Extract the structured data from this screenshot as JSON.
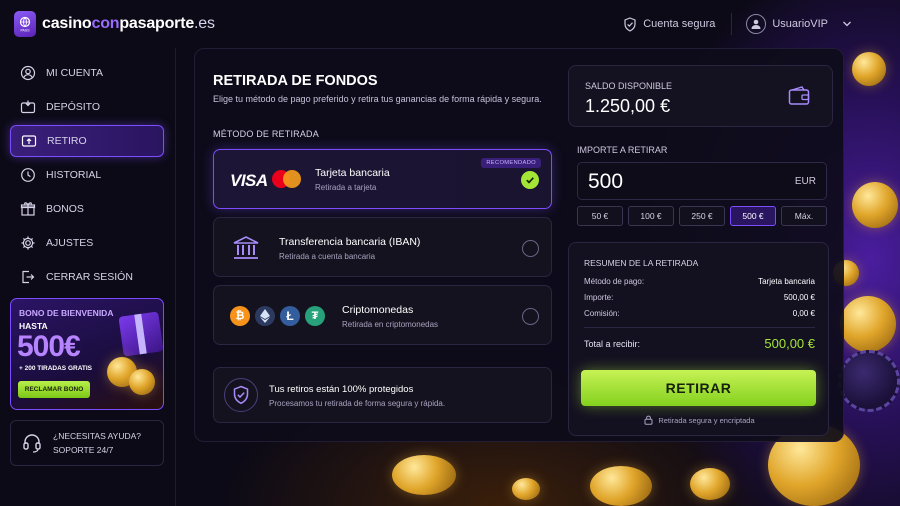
{
  "header": {
    "logo_part1": "casino",
    "logo_part2": "con",
    "logo_part3": "pasaporte",
    "logo_part4": ".es",
    "logo_badge": "PASS",
    "secure_account": "Cuenta segura",
    "username": "UsuarioVIP"
  },
  "sidebar": {
    "items": [
      {
        "label": "MI CUENTA",
        "icon": "user-icon"
      },
      {
        "label": "DEPÓSITO",
        "icon": "wallet-icon"
      },
      {
        "label": "RETIRO",
        "icon": "withdraw-icon"
      },
      {
        "label": "HISTORIAL",
        "icon": "clock-icon"
      },
      {
        "label": "BONOS",
        "icon": "gift-icon"
      },
      {
        "label": "AJUSTES",
        "icon": "gear-icon"
      },
      {
        "label": "CERRAR SESIÓN",
        "icon": "logout-icon"
      }
    ],
    "active_index": 2,
    "promo": {
      "title": "BONO DE BIENVENIDA",
      "upto": "HASTA",
      "amount": "500€",
      "extra": "+ 200 TIRADAS GRATIS",
      "button": "RECLAMAR BONO"
    },
    "help": {
      "line1": "¿NECESITAS AYUDA?",
      "line2": "SOPORTE 24/7"
    }
  },
  "main": {
    "title": "RETIRADA DE FONDOS",
    "subtitle": "Elige tu método de pago preferido y retira tus ganancias de forma rápida y segura.",
    "method_label": "MÉTODO DE RETIRADA",
    "methods": [
      {
        "title": "Tarjeta bancaria",
        "subtitle": "Retirada a tarjeta",
        "badge": "RECOMENDADO",
        "selected": true,
        "brand": "VISA"
      },
      {
        "title": "Transferencia bancaria (IBAN)",
        "subtitle": "Retirada a cuenta bancaria",
        "selected": false
      },
      {
        "title": "Criptomonedas",
        "subtitle": "Retirada en criptomonedas",
        "selected": false
      }
    ],
    "protection": {
      "title": "Tus retiros están 100% protegidos",
      "subtitle": "Procesamos tu retirada de forma segura y rápida."
    }
  },
  "balance": {
    "label": "SALDO DISPONIBLE",
    "value": "1.250,00 €"
  },
  "amount": {
    "label": "IMPORTE A RETIRAR",
    "value": "500",
    "currency": "EUR",
    "quick": [
      "50 €",
      "100 €",
      "250 €",
      "500 €",
      "Máx."
    ],
    "quick_active": 3
  },
  "summary": {
    "title": "RESUMEN DE LA RETIRADA",
    "rows": [
      {
        "label": "Método de pago:",
        "value": "Tarjeta bancaria"
      },
      {
        "label": "Importe:",
        "value": "500,00 €"
      },
      {
        "label": "Comisión:",
        "value": "0,00 €"
      }
    ],
    "total_label": "Total a recibir:",
    "total_value": "500,00 €",
    "button": "RETIRAR",
    "secure_note": "Retirada segura y encriptada"
  },
  "colors": {
    "accent_purple": "#7c4dff",
    "accent_green": "#a3e635",
    "background": "#0c0a16"
  }
}
